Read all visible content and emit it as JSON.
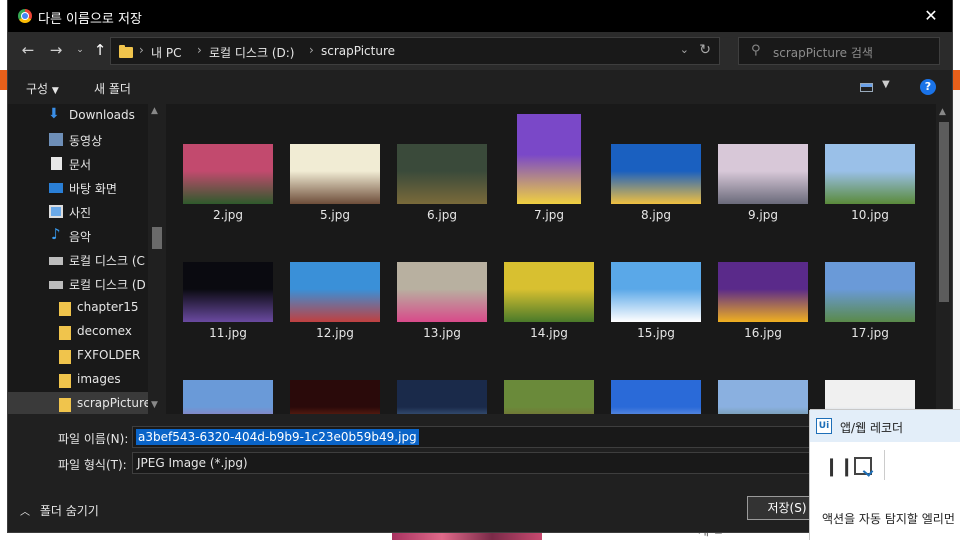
{
  "window": {
    "title": "다른 이름으로 저장"
  },
  "navigation": {
    "path": [
      "내 PC",
      "로컬 디스크 (D:)",
      "scrapPicture"
    ],
    "search_placeholder": "scrapPicture 검색"
  },
  "toolbar": {
    "organize_label": "구성",
    "new_folder_label": "새 폴더"
  },
  "sidebar": {
    "items": [
      {
        "label": "Downloads",
        "icon": "download-icon"
      },
      {
        "label": "동영상",
        "icon": "video-icon"
      },
      {
        "label": "문서",
        "icon": "document-icon"
      },
      {
        "label": "바탕 화면",
        "icon": "desktop-icon"
      },
      {
        "label": "사진",
        "icon": "pictures-icon"
      },
      {
        "label": "음악",
        "icon": "music-icon"
      },
      {
        "label": "로컬 디스크 (C",
        "icon": "drive-icon"
      },
      {
        "label": "로컬 디스크 (D",
        "icon": "drive-icon"
      },
      {
        "label": "chapter15",
        "icon": "folder-icon"
      },
      {
        "label": "decomex",
        "icon": "folder-icon"
      },
      {
        "label": "FXFOLDER",
        "icon": "folder-icon"
      },
      {
        "label": "images",
        "icon": "folder-icon"
      },
      {
        "label": "scrapPicture",
        "icon": "folder-icon",
        "selected": true
      }
    ]
  },
  "files": [
    {
      "name": "2.jpg",
      "colors": [
        "#c24a6e",
        "#2f5a2c"
      ]
    },
    {
      "name": "5.jpg",
      "colors": [
        "#f1ecd4",
        "#6e4e3a"
      ]
    },
    {
      "name": "6.jpg",
      "colors": [
        "#3a4a3a",
        "#7a6a3a"
      ]
    },
    {
      "name": "7.jpg",
      "colors": [
        "#7a48c8",
        "#f0d040"
      ]
    },
    {
      "name": "8.jpg",
      "colors": [
        "#1a60c0",
        "#f0c040"
      ]
    },
    {
      "name": "9.jpg",
      "colors": [
        "#d8c8d8",
        "#6a6a7a"
      ]
    },
    {
      "name": "10.jpg",
      "colors": [
        "#9ac0e8",
        "#5a8a3a"
      ]
    },
    {
      "name": "11.jpg",
      "colors": [
        "#0a0a10",
        "#6a4aa0"
      ]
    },
    {
      "name": "12.jpg",
      "colors": [
        "#3a90d8",
        "#c04040"
      ]
    },
    {
      "name": "13.jpg",
      "colors": [
        "#b8b0a0",
        "#d84a8a"
      ]
    },
    {
      "name": "14.jpg",
      "colors": [
        "#d8c030",
        "#4a7a2a"
      ]
    },
    {
      "name": "15.jpg",
      "colors": [
        "#5aa8e8",
        "#ffffff"
      ]
    },
    {
      "name": "16.jpg",
      "colors": [
        "#5a2a8a",
        "#f0b020"
      ]
    },
    {
      "name": "17.jpg",
      "colors": [
        "#6a9ad8",
        "#5a8a4a"
      ]
    },
    {
      "name": "",
      "colors": [
        "#6a9ad8",
        "#d84a8a"
      ]
    },
    {
      "name": "",
      "colors": [
        "#2a0a0a",
        "#e05020"
      ]
    },
    {
      "name": "",
      "colors": [
        "#1a2a4a",
        "#8ab8e8"
      ]
    },
    {
      "name": "",
      "colors": [
        "#6a8a3a",
        "#8a3a2a"
      ]
    },
    {
      "name": "",
      "colors": [
        "#2a6ad8",
        "#e0e0f0"
      ]
    },
    {
      "name": "",
      "colors": [
        "#8ab0e0",
        "#4a6a3a"
      ]
    },
    {
      "name": "",
      "colors": [
        "#f0f0f0",
        "#2a6ab8"
      ]
    }
  ],
  "form": {
    "filename_label": "파일 이름(N):",
    "filename_value": "a3bef543-6320-404d-b9b9-1c23e0b59b49.jpg",
    "filetype_label": "파일 형식(T):",
    "filetype_value": "JPEG Image (*.jpg)",
    "hide_folders_label": "폴더 숨기기",
    "save_label": "저장(S)"
  },
  "recorder": {
    "title": "앱/웹 레코더",
    "logo_text": "Ui",
    "message": "액션을 자동 탐지할 엘리먼"
  },
  "background": {
    "footer_text": "게 ㅂ"
  }
}
